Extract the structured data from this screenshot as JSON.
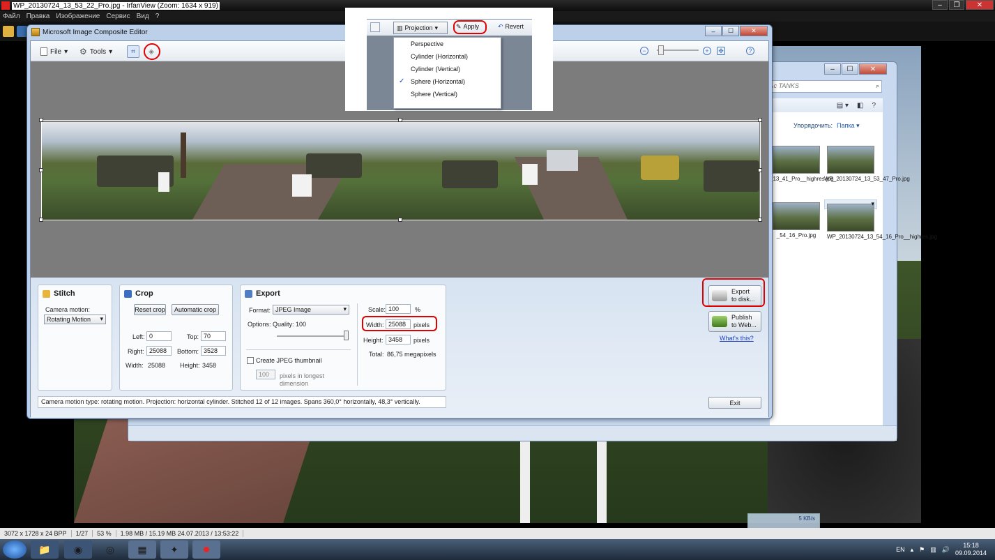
{
  "irfanview": {
    "title": "WP_20130724_13_53_22_Pro.jpg - IrfanView (Zoom: 1634 x 919)",
    "menu": [
      "Файл",
      "Правка",
      "Изображение",
      "Сервис",
      "Вид",
      "?"
    ],
    "status": {
      "dims": "3072 x 1728 x 24 BPP",
      "index": "1/27",
      "zoom": "53 %",
      "size": "1.98 MB / 15.19 MB 24.07.2013 / 13:53:22"
    }
  },
  "explorer": {
    "search_placeholder": "ъс TANKS",
    "sort_label": "Упорядочить:",
    "sort_value": "Папка",
    "thumbnails": [
      {
        "caption": "_13_41_Pro__highres.jpg"
      },
      {
        "caption": "WP_20130724_13_53_47_Pro.jpg"
      },
      {
        "caption": "_54_16_Pro.jpg"
      },
      {
        "caption": "WP_20130724_13_54_16_Pro__highres.jpg"
      }
    ]
  },
  "ice": {
    "title": "Microsoft Image Composite Editor",
    "toolbar": {
      "file": "File",
      "tools": "Tools"
    },
    "stitch": {
      "heading": "Stitch",
      "camera_motion_label": "Camera motion:",
      "camera_motion_value": "Rotating Motion"
    },
    "crop": {
      "heading": "Crop",
      "reset": "Reset crop",
      "auto": "Automatic crop",
      "left_label": "Left:",
      "left": "0",
      "top_label": "Top:",
      "top": "70",
      "right_label": "Right:",
      "right": "25088",
      "bottom_label": "Bottom:",
      "bottom": "3528",
      "width_label": "Width:",
      "width": "25088",
      "height_label": "Height:",
      "height": "3458"
    },
    "export": {
      "heading": "Export",
      "format_label": "Format:",
      "format_value": "JPEG Image",
      "options_label": "Options: Quality: 100",
      "thumbnail_label": "Create JPEG thumbnail",
      "thumb_size": "100",
      "thumb_hint_1": "pixels in longest",
      "thumb_hint_2": "dimension",
      "scale_label": "Scale:",
      "scale": "100",
      "scale_unit": "%",
      "width_label": "Width:",
      "width": "25088",
      "width_unit": "pixels",
      "height_label": "Height:",
      "height": "3458",
      "height_unit": "pixels",
      "total_label": "Total:",
      "total": "86,75 megapixels"
    },
    "actions": {
      "export_line1": "Export",
      "export_line2": "to disk...",
      "publish_line1": "Publish",
      "publish_line2": "to Web...",
      "whats_this": "What's this?",
      "exit": "Exit"
    },
    "status": "Camera motion type: rotating motion. Projection: horizontal cylinder. Stitched 12 of 12 images. Spans 360,0° horizontally, 48,3° vertically."
  },
  "inset": {
    "projection": "Projection",
    "apply": "Apply",
    "revert": "Revert",
    "options": [
      "Perspective",
      "Cylinder (Horizontal)",
      "Cylinder (Vertical)",
      "Sphere (Horizontal)",
      "Sphere (Vertical)"
    ],
    "checked": "Sphere (Horizontal)"
  },
  "taskbar": {
    "lang": "EN",
    "time": "15:18",
    "date": "09.09.2014",
    "net": "5 KB/s"
  },
  "colors": {
    "annotation_red": "#e00000",
    "link_blue": "#1a3fc2"
  }
}
